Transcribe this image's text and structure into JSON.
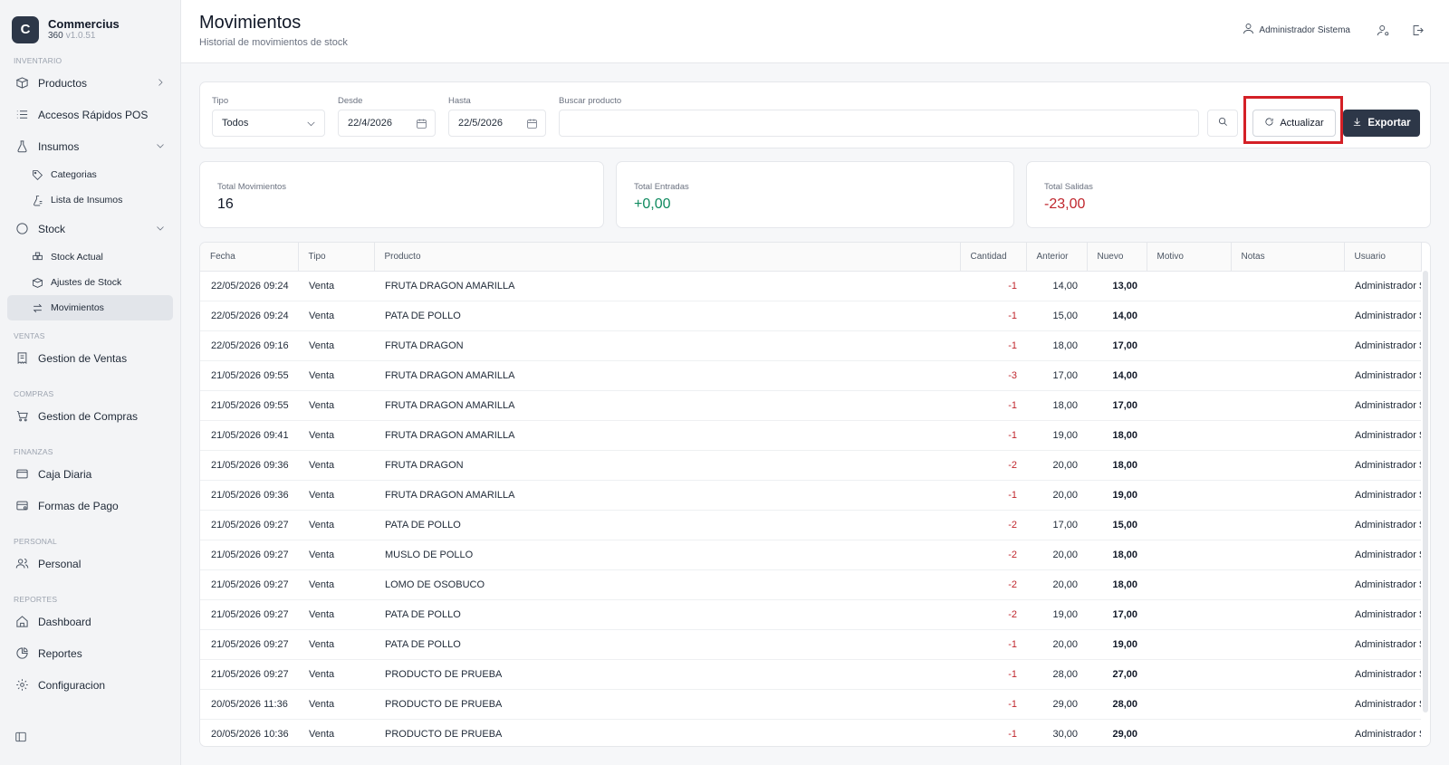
{
  "brand": {
    "logo_letter": "C",
    "name": "Commercius",
    "product": "360",
    "version": "v1.0.51"
  },
  "sidebar": {
    "sections": {
      "inventario": "INVENTARIO",
      "ventas": "VENTAS",
      "compras": "COMPRAS",
      "finanzas": "FINANZAS",
      "personal": "PERSONAL",
      "reportes": "REPORTES"
    },
    "items": {
      "productos": "Productos",
      "accesos": "Accesos Rápidos POS",
      "insumos": "Insumos",
      "categorias": "Categorias",
      "lista_insumos": "Lista de Insumos",
      "stock": "Stock",
      "stock_actual": "Stock Actual",
      "ajustes_stock": "Ajustes de Stock",
      "movimientos": "Movimientos",
      "gestion_ventas": "Gestion de Ventas",
      "gestion_compras": "Gestion de Compras",
      "caja_diaria": "Caja Diaria",
      "formas_pago": "Formas de Pago",
      "personal": "Personal",
      "dashboard": "Dashboard",
      "reportes": "Reportes",
      "configuracion": "Configuracion"
    }
  },
  "header": {
    "title": "Movimientos",
    "subtitle": "Historial de movimientos de stock",
    "user_name": "Administrador Sistema"
  },
  "filters": {
    "tipo_label": "Tipo",
    "tipo_value": "Todos",
    "desde_label": "Desde",
    "desde_value": "22/4/2026",
    "hasta_label": "Hasta",
    "hasta_value": "22/5/2026",
    "buscar_label": "Buscar producto",
    "buscar_value": "",
    "refresh_label": "Actualizar",
    "export_label": "Exportar"
  },
  "stats": {
    "total_movimientos_label": "Total Movimientos",
    "total_movimientos_value": "16",
    "total_entradas_label": "Total Entradas",
    "total_entradas_value": "+0,00",
    "total_salidas_label": "Total Salidas",
    "total_salidas_value": "-23,00"
  },
  "table": {
    "columns": [
      "Fecha",
      "Tipo",
      "Producto",
      "Cantidad",
      "Anterior",
      "Nuevo",
      "Motivo",
      "Notas",
      "Usuario"
    ],
    "rows": [
      [
        "22/05/2026 09:24",
        "Venta",
        "FRUTA DRAGON AMARILLA",
        "-1",
        "14,00",
        "13,00",
        "",
        "",
        "Administrador Sistema"
      ],
      [
        "22/05/2026 09:24",
        "Venta",
        "PATA DE POLLO",
        "-1",
        "15,00",
        "14,00",
        "",
        "",
        "Administrador Sistema"
      ],
      [
        "22/05/2026 09:16",
        "Venta",
        "FRUTA DRAGON",
        "-1",
        "18,00",
        "17,00",
        "",
        "",
        "Administrador Sistema"
      ],
      [
        "21/05/2026 09:55",
        "Venta",
        "FRUTA DRAGON AMARILLA",
        "-3",
        "17,00",
        "14,00",
        "",
        "",
        "Administrador Sistema"
      ],
      [
        "21/05/2026 09:55",
        "Venta",
        "FRUTA DRAGON AMARILLA",
        "-1",
        "18,00",
        "17,00",
        "",
        "",
        "Administrador Sistema"
      ],
      [
        "21/05/2026 09:41",
        "Venta",
        "FRUTA DRAGON AMARILLA",
        "-1",
        "19,00",
        "18,00",
        "",
        "",
        "Administrador Sistema"
      ],
      [
        "21/05/2026 09:36",
        "Venta",
        "FRUTA DRAGON",
        "-2",
        "20,00",
        "18,00",
        "",
        "",
        "Administrador Sistema"
      ],
      [
        "21/05/2026 09:36",
        "Venta",
        "FRUTA DRAGON AMARILLA",
        "-1",
        "20,00",
        "19,00",
        "",
        "",
        "Administrador Sistema"
      ],
      [
        "21/05/2026 09:27",
        "Venta",
        "PATA DE POLLO",
        "-2",
        "17,00",
        "15,00",
        "",
        "",
        "Administrador Sistema"
      ],
      [
        "21/05/2026 09:27",
        "Venta",
        "MUSLO DE POLLO",
        "-2",
        "20,00",
        "18,00",
        "",
        "",
        "Administrador Sistema"
      ],
      [
        "21/05/2026 09:27",
        "Venta",
        "LOMO DE OSOBUCO",
        "-2",
        "20,00",
        "18,00",
        "",
        "",
        "Administrador Sistema"
      ],
      [
        "21/05/2026 09:27",
        "Venta",
        "PATA DE POLLO",
        "-2",
        "19,00",
        "17,00",
        "",
        "",
        "Administrador Sistema"
      ],
      [
        "21/05/2026 09:27",
        "Venta",
        "PATA DE POLLO",
        "-1",
        "20,00",
        "19,00",
        "",
        "",
        "Administrador Sistema"
      ],
      [
        "21/05/2026 09:27",
        "Venta",
        "PRODUCTO DE PRUEBA",
        "-1",
        "28,00",
        "27,00",
        "",
        "",
        "Administrador Sistema"
      ],
      [
        "20/05/2026 11:36",
        "Venta",
        "PRODUCTO DE PRUEBA",
        "-1",
        "29,00",
        "28,00",
        "",
        "",
        "Administrador Sistema"
      ],
      [
        "20/05/2026 10:36",
        "Venta",
        "PRODUCTO DE PRUEBA",
        "-1",
        "30,00",
        "29,00",
        "",
        "",
        "Administrador Sistema"
      ]
    ]
  },
  "colors": {
    "primary": "#2d3748",
    "positive": "#0f8a5f",
    "negative": "#c0262d",
    "highlight": "#d42026"
  }
}
